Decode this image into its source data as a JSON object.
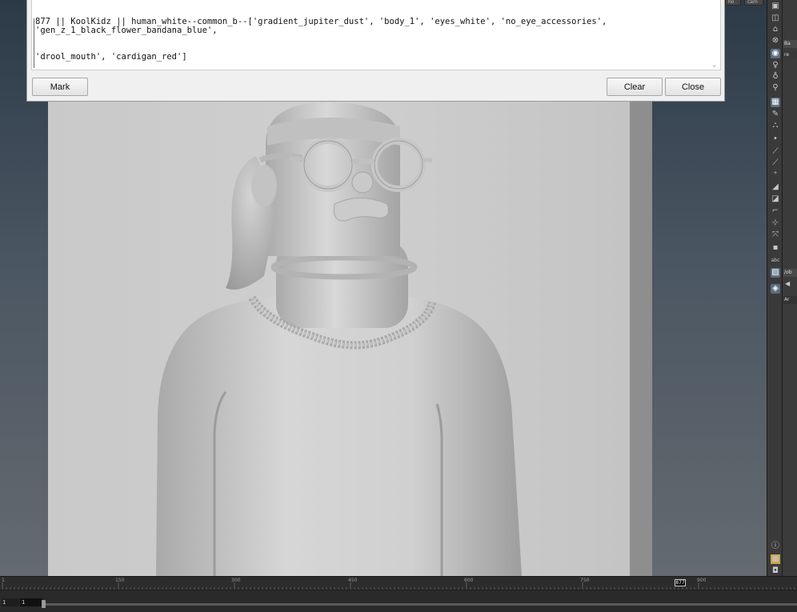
{
  "dialog": {
    "text_lines": [
      "877 || KoolKidz || human_white--common_b--['gradient_jupiter_dust', 'body_1', 'eyes_white', 'no_eye_accessories', 'gen_z_1_black_flower_bandana_blue',",
      "'drool_mouth', 'cardigan_red']"
    ],
    "mark_label": "Mark",
    "clear_label": "Clear",
    "close_label": "Close"
  },
  "top_chips": [
    "ho",
    "cam"
  ],
  "timeline": {
    "tick_labels": [
      "1",
      "150",
      "300",
      "450",
      "600",
      "750",
      "900"
    ],
    "current_frame": "877",
    "start_frame": "1",
    "end_frame": "1"
  },
  "right_panel": {
    "tabs": [
      "Ba",
      "re",
      "/ob",
      "Ar"
    ],
    "shelf_icons": [
      "view-icon",
      "snapshot-icon",
      "lock-icon",
      "camera-icon",
      "display-icon",
      "light-icon",
      "pose-icon",
      "handle-icon",
      "select-icon",
      "grid-icon",
      "paint-icon",
      "transform-icon",
      "point-icon",
      "brush-icon",
      "measure-icon",
      "annotate-icon",
      "audio-icon",
      "slope-icon",
      "crop-icon",
      "path-icon",
      "pin-icon",
      "box-icon",
      "text-icon",
      "image-icon",
      "marker-icon",
      "info-icon",
      "layout-icon",
      "render-icon"
    ]
  }
}
